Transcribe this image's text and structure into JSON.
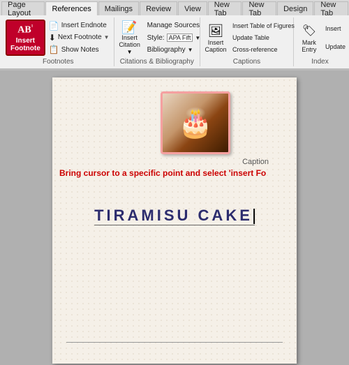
{
  "tabs": [
    {
      "label": "Page Layout",
      "active": false
    },
    {
      "label": "References",
      "active": true
    },
    {
      "label": "Mailings",
      "active": false
    },
    {
      "label": "Review",
      "active": false
    },
    {
      "label": "View",
      "active": false
    },
    {
      "label": "New Tab",
      "active": false
    },
    {
      "label": "New Tab",
      "active": false
    },
    {
      "label": "Design",
      "active": false
    },
    {
      "label": "New Tab",
      "active": false
    }
  ],
  "groups": {
    "footnotes": {
      "label": "Footnotes",
      "insert_footnote": {
        "label": "Insert\nFootnote",
        "icon": "AB¹"
      },
      "insert_endnote": {
        "label": "Insert Endnote"
      },
      "next_footnote": {
        "label": "Next Footnote"
      },
      "show_notes": {
        "label": "Show Notes"
      }
    },
    "citations": {
      "label": "Citations & Bibliography",
      "manage_sources": {
        "label": "Manage Sources"
      },
      "style": {
        "label": "Style:",
        "value": "APA Fift"
      },
      "bibliography": {
        "label": "Bibliography"
      },
      "insert_citation": {
        "label": "Insert\nCitation"
      },
      "arrow": "▼"
    },
    "captions": {
      "label": "Captions",
      "insert_caption": {
        "label": "Insert\nCaption"
      },
      "insert_table_of_figures": {
        "label": "Insert Table of Figures"
      },
      "update_table": {
        "label": "Update Table"
      },
      "cross_reference": {
        "label": "Cross-reference"
      }
    },
    "index": {
      "label": "Index",
      "mark_entry": {
        "label": "Mark\nEntry"
      },
      "insert_index": {
        "label": "Insert\nIndex"
      },
      "update_index": {
        "label": "Update Index"
      }
    }
  },
  "document": {
    "instruction": "Bring cursor to a specific point and select 'insert Fo",
    "title": "TIRAMISU CAKE"
  },
  "caption_label": "Caption"
}
